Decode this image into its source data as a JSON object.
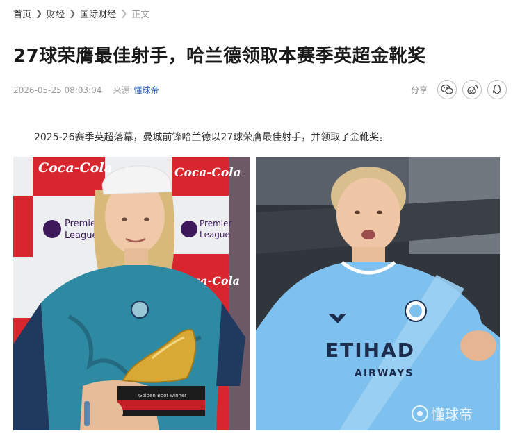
{
  "breadcrumb": {
    "items": [
      "首页",
      "财经",
      "国际财经"
    ],
    "current": "正文"
  },
  "article": {
    "title": "27球荣膺最佳射手，哈兰德领取本赛季英超金靴奖",
    "datetime": "2026-05-25 08:03:04",
    "source_label": "来源:",
    "source": "懂球帝",
    "lead": "2025-26赛季英超落幕，曼城前锋哈兰德以27球荣膺最佳射手，并领取了金靴奖。"
  },
  "share": {
    "label": "分享",
    "buttons": [
      "wechat-icon",
      "weibo-icon",
      "qq-icon"
    ]
  },
  "images": {
    "left": {
      "sponsor_text": "Coca-Cola",
      "league_text_1": "Premier",
      "league_text_2": "League",
      "trophy_plate_text": "Golden Boot winner"
    },
    "right": {
      "shirt_text_1": "ETIHAD",
      "shirt_text_2": "AIRWAYS",
      "watermark": "懂球帝"
    }
  },
  "colors": {
    "accent_link": "#2a62b8",
    "city_blue": "#7ec0ee",
    "coca_red": "#d7262e"
  }
}
